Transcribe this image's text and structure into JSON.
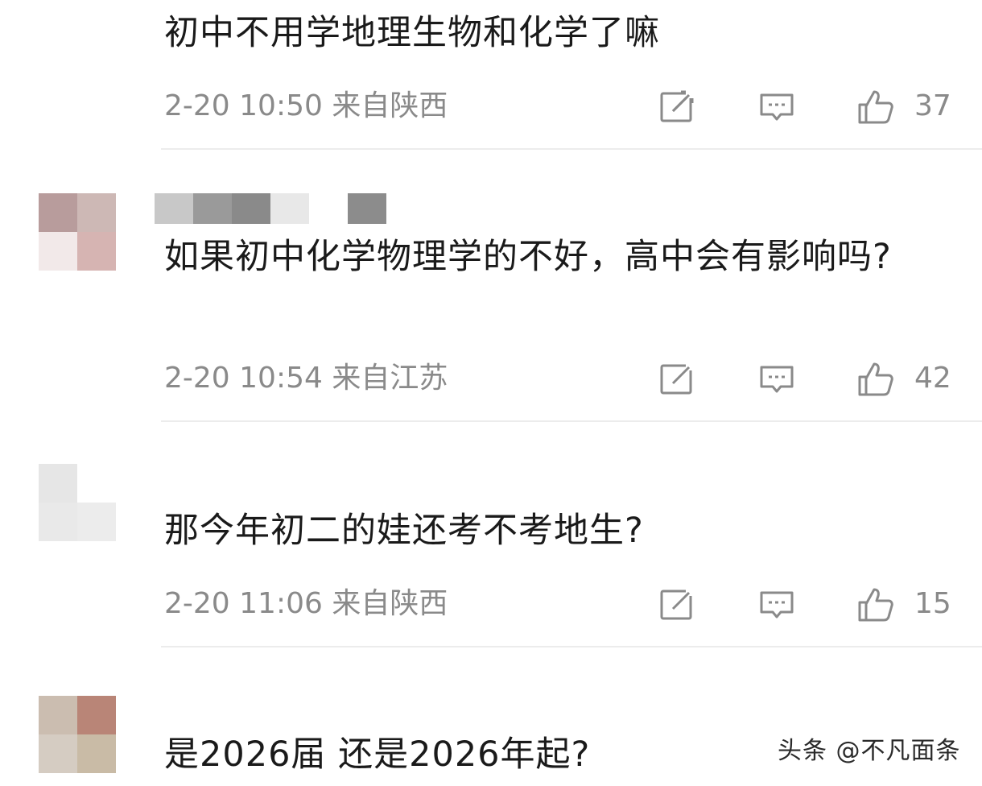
{
  "comments": [
    {
      "text": "初中不用学地理生物和化学了嘛",
      "time": "2-20 10:50",
      "location": "来自陕西",
      "likes": "37",
      "avatar_colors": [
        "#2a1410",
        "#a35c38",
        "#ffffff",
        "#ffffff"
      ]
    },
    {
      "text": "如果初中化学物理学的不好，高中会有影响吗?",
      "time": "2-20 10:54",
      "location": "来自江苏",
      "likes": "42",
      "avatar_colors": [
        "#b89c9c",
        "#cdb8b5",
        "#f2e9e9",
        "#d6b4b2"
      ],
      "name_blur_colors": [
        "#c8c8c8",
        "#9a9a9a",
        "#8a8a8a",
        "#e8e8e8",
        "#ffffff",
        "#8c8c8c"
      ]
    },
    {
      "text": "那今年初二的娃还考不考地生?",
      "time": "2-20 11:06",
      "location": "来自陕西",
      "likes": "15",
      "avatar_colors": [
        "#e6e6e6",
        "#ffffff",
        "#e9e9e9",
        "#ececec"
      ]
    },
    {
      "text": "是2026届 还是2026年起?",
      "avatar_colors": [
        "#cbbdb0",
        "#b98577",
        "#d5ccc2",
        "#c9bba6"
      ]
    }
  ],
  "watermark": "头条 @不凡面条",
  "icons": {
    "share": "share-icon",
    "reply": "comment-icon",
    "like": "thumbs-up-icon"
  },
  "colors": {
    "text": "#1a1a1a",
    "meta": "#8a8a8a",
    "divider": "#ececec"
  }
}
